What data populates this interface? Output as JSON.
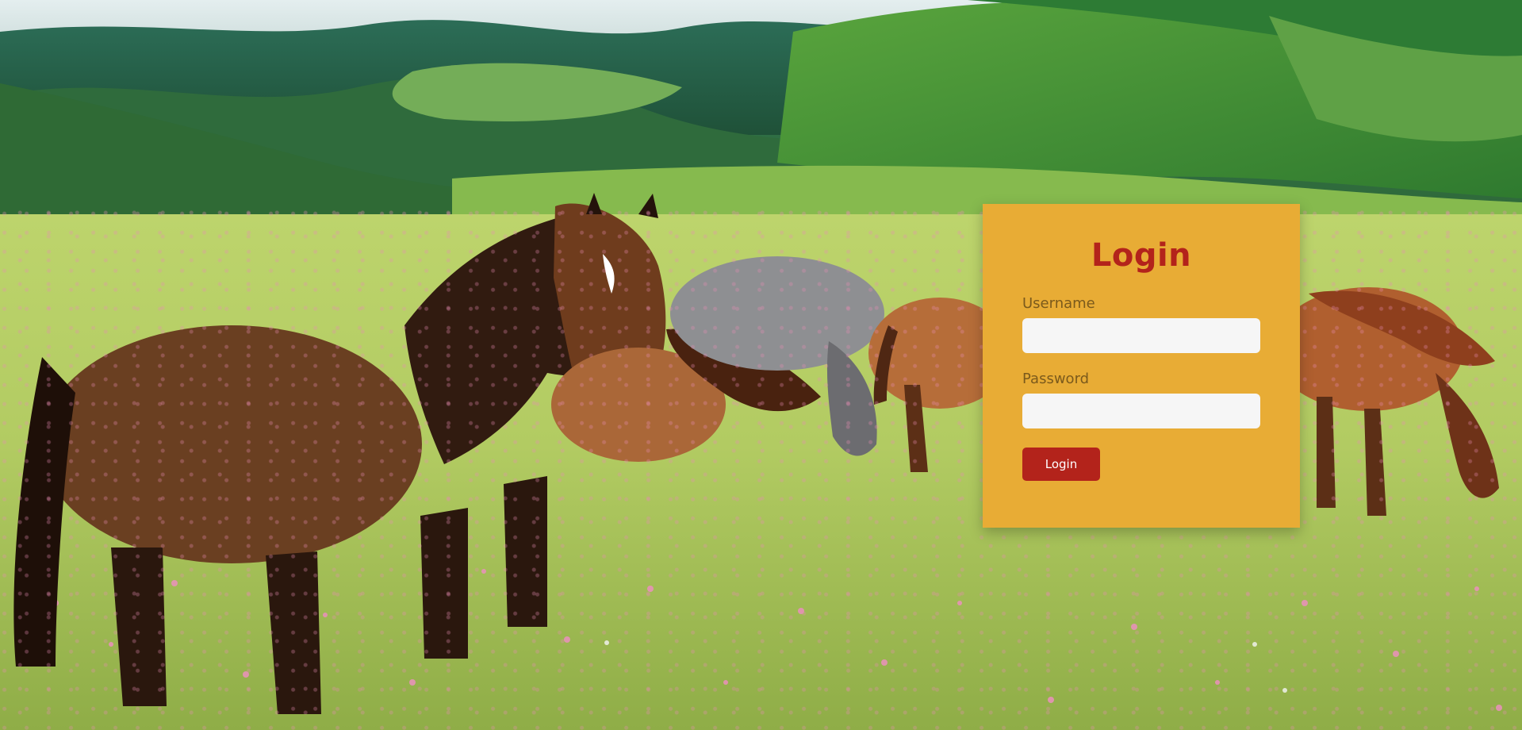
{
  "login": {
    "title": "Login",
    "username_label": "Username",
    "username_value": "",
    "password_label": "Password",
    "password_value": "",
    "submit_label": "Login"
  },
  "colors": {
    "card_background": "#e8ac35",
    "accent_red": "#b3231b",
    "input_background": "#f6f6f6",
    "label_text": "#7b5a1c"
  }
}
